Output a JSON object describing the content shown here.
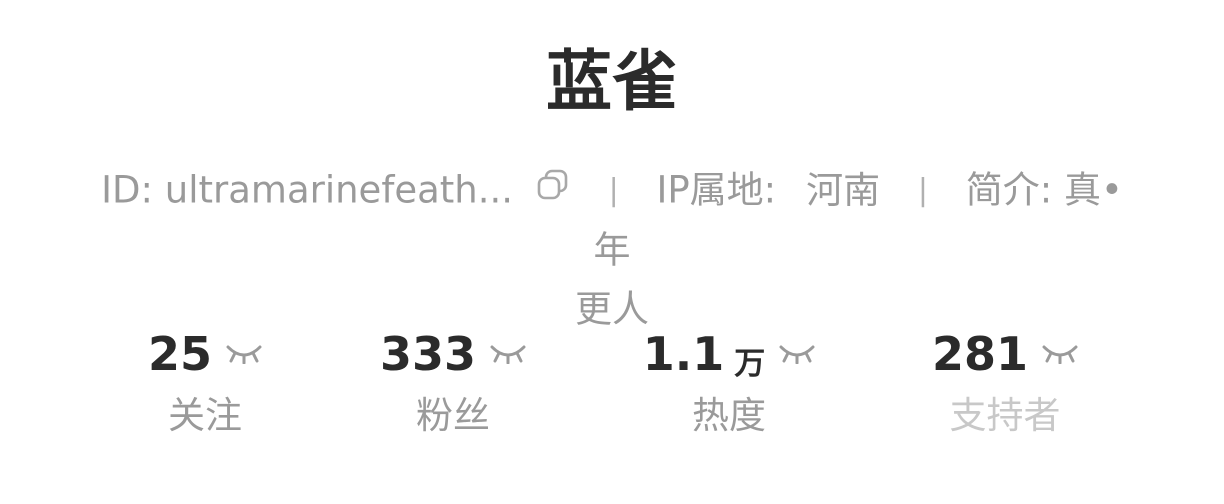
{
  "profile": {
    "name": "蓝雀",
    "id_label": "ID: ",
    "id_value": "ultramarinefeath...",
    "separator": "|",
    "ip_label": "IP属地:",
    "ip_value": "河南",
    "bio_label": "简介: ",
    "bio_line1": "真•年",
    "bio_line2": "更人"
  },
  "icons": {
    "copy": "copy-icon",
    "closed_eye": "closed-eye-icon"
  },
  "stats": [
    {
      "value": "25",
      "unit": "",
      "label": "关注"
    },
    {
      "value": "333",
      "unit": "",
      "label": "粉丝"
    },
    {
      "value": "1.1",
      "unit": "万",
      "label": "热度"
    },
    {
      "value": "281",
      "unit": "",
      "label": "支持者"
    }
  ],
  "colors": {
    "text_primary": "#2b2b2b",
    "text_secondary": "#9a9a9a",
    "text_muted": "#c8c8c8"
  }
}
